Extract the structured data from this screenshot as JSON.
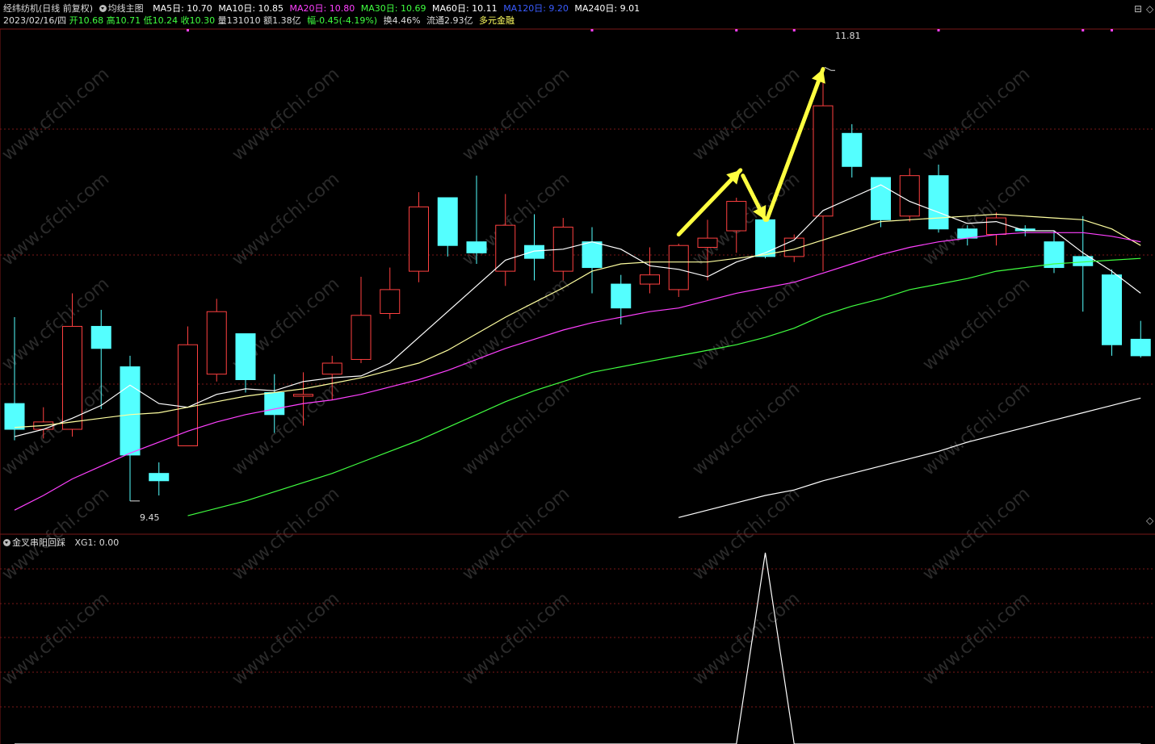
{
  "header": {
    "title": "经纬纺机(日线 前复权)",
    "indicator": "均线主图",
    "ma": [
      {
        "label": "MA5日: 10.70",
        "color": "#ffffff"
      },
      {
        "label": "MA10日: 10.85",
        "color": "#ffffff"
      },
      {
        "label": "MA20日: 10.80",
        "color": "#ff40ff"
      },
      {
        "label": "MA30日: 10.69",
        "color": "#40ff40"
      },
      {
        "label": "MA60日: 10.11",
        "color": "#ffffff"
      },
      {
        "label": "MA120日: 9.20",
        "color": "#3a5cff"
      },
      {
        "label": "MA240日: 9.01",
        "color": "#ffffff"
      }
    ]
  },
  "quote": {
    "date": "2023/02/16/四",
    "open": "开10.68",
    "high": "高10.71",
    "low": "低10.24",
    "close": "收10.30",
    "volume": "量131010",
    "amount": "额1.38亿",
    "change": "幅-0.45(-4.19%)",
    "turnover": "换4.46%",
    "float": "流通2.93亿",
    "margin": "多元金融"
  },
  "sub_header": {
    "indicator": "金叉串阳回踩",
    "value": "XG1: 0.00"
  },
  "controls": {
    "menu_icon": "⊟",
    "expand_icon": "◇"
  },
  "annotations": {
    "high_label": "11.81",
    "low_label": "9.45"
  },
  "watermark": "www.cfchi.com",
  "colors": {
    "up": "#ff4040",
    "down": "#54ffff",
    "grid": "#7a1818",
    "arrow": "#ffff40",
    "ma5": "#ffffff",
    "ma10": "#ffffa0",
    "ma20": "#ff40ff",
    "ma30": "#40ff40",
    "ma60": "#ffffff"
  },
  "chart_data": {
    "type": "candlestick",
    "price_range": [
      9.3,
      12.0
    ],
    "candles": [
      {
        "o": 9.98,
        "h": 10.45,
        "l": 9.78,
        "c": 9.84
      },
      {
        "o": 9.84,
        "h": 9.96,
        "l": 9.79,
        "c": 9.88
      },
      {
        "o": 9.84,
        "h": 10.58,
        "l": 9.8,
        "c": 10.4
      },
      {
        "o": 10.4,
        "h": 10.49,
        "l": 9.95,
        "c": 10.28
      },
      {
        "o": 10.18,
        "h": 10.24,
        "l": 9.45,
        "c": 9.7
      },
      {
        "o": 9.6,
        "h": 9.66,
        "l": 9.48,
        "c": 9.56
      },
      {
        "o": 9.75,
        "h": 10.4,
        "l": 9.75,
        "c": 10.3
      },
      {
        "o": 10.14,
        "h": 10.55,
        "l": 10.1,
        "c": 10.48
      },
      {
        "o": 10.36,
        "h": 10.36,
        "l": 10.04,
        "c": 10.11
      },
      {
        "o": 10.04,
        "h": 10.14,
        "l": 9.82,
        "c": 9.92
      },
      {
        "o": 10.02,
        "h": 10.15,
        "l": 9.86,
        "c": 10.03
      },
      {
        "o": 10.14,
        "h": 10.24,
        "l": 10.0,
        "c": 10.2
      },
      {
        "o": 10.22,
        "h": 10.67,
        "l": 10.2,
        "c": 10.46
      },
      {
        "o": 10.47,
        "h": 10.72,
        "l": 10.44,
        "c": 10.6
      },
      {
        "o": 10.7,
        "h": 11.13,
        "l": 10.64,
        "c": 11.05
      },
      {
        "o": 11.1,
        "h": 11.1,
        "l": 10.78,
        "c": 10.84
      },
      {
        "o": 10.86,
        "h": 11.22,
        "l": 10.74,
        "c": 10.8
      },
      {
        "o": 10.7,
        "h": 11.12,
        "l": 10.62,
        "c": 10.95
      },
      {
        "o": 10.84,
        "h": 11.01,
        "l": 10.65,
        "c": 10.77
      },
      {
        "o": 10.7,
        "h": 10.99,
        "l": 10.65,
        "c": 10.94
      },
      {
        "o": 10.86,
        "h": 10.94,
        "l": 10.58,
        "c": 10.72
      },
      {
        "o": 10.63,
        "h": 10.68,
        "l": 10.41,
        "c": 10.5
      },
      {
        "o": 10.63,
        "h": 10.83,
        "l": 10.58,
        "c": 10.68
      },
      {
        "o": 10.6,
        "h": 10.85,
        "l": 10.56,
        "c": 10.84
      },
      {
        "o": 10.83,
        "h": 10.98,
        "l": 10.65,
        "c": 10.88
      },
      {
        "o": 10.92,
        "h": 11.1,
        "l": 10.8,
        "c": 11.08
      },
      {
        "o": 10.98,
        "h": 11.0,
        "l": 10.77,
        "c": 10.78
      },
      {
        "o": 10.78,
        "h": 10.9,
        "l": 10.75,
        "c": 10.88
      },
      {
        "o": 11.0,
        "h": 11.81,
        "l": 10.7,
        "c": 11.6
      },
      {
        "o": 11.45,
        "h": 11.5,
        "l": 11.21,
        "c": 11.27
      },
      {
        "o": 11.21,
        "h": 11.21,
        "l": 10.94,
        "c": 10.98
      },
      {
        "o": 11.0,
        "h": 11.26,
        "l": 10.97,
        "c": 11.22
      },
      {
        "o": 11.22,
        "h": 11.28,
        "l": 10.91,
        "c": 10.93
      },
      {
        "o": 10.93,
        "h": 10.95,
        "l": 10.84,
        "c": 10.88
      },
      {
        "o": 10.9,
        "h": 11.02,
        "l": 10.84,
        "c": 10.99
      },
      {
        "o": 10.93,
        "h": 10.95,
        "l": 10.89,
        "c": 10.92
      },
      {
        "o": 10.86,
        "h": 10.92,
        "l": 10.69,
        "c": 10.72
      },
      {
        "o": 10.78,
        "h": 11.0,
        "l": 10.48,
        "c": 10.73
      },
      {
        "o": 10.68,
        "h": 10.71,
        "l": 10.24,
        "c": 10.3
      },
      {
        "o": 10.33,
        "h": 10.43,
        "l": 10.23,
        "c": 10.24
      }
    ],
    "ma5": [
      9.8,
      9.84,
      9.9,
      9.97,
      10.08,
      9.98,
      9.96,
      10.03,
      10.06,
      10.05,
      10.1,
      10.12,
      10.13,
      10.2,
      10.34,
      10.48,
      10.62,
      10.76,
      10.81,
      10.82,
      10.86,
      10.82,
      10.73,
      10.71,
      10.67,
      10.75,
      10.8,
      10.87,
      11.03,
      11.1,
      11.17,
      11.08,
      11.02,
      10.96,
      10.97,
      10.92,
      10.92,
      10.8,
      10.7,
      10.58
    ],
    "ma10": [
      9.85,
      9.86,
      9.88,
      9.9,
      9.92,
      9.93,
      9.96,
      9.99,
      10.02,
      10.04,
      10.06,
      10.09,
      10.12,
      10.16,
      10.2,
      10.27,
      10.36,
      10.45,
      10.53,
      10.61,
      10.7,
      10.74,
      10.75,
      10.75,
      10.75,
      10.77,
      10.79,
      10.82,
      10.87,
      10.92,
      10.97,
      10.98,
      10.99,
      11.0,
      11.01,
      11.0,
      10.99,
      10.98,
      10.93,
      10.84
    ],
    "ma20": [
      9.4,
      9.48,
      9.57,
      9.64,
      9.71,
      9.77,
      9.83,
      9.88,
      9.92,
      9.95,
      9.98,
      10.0,
      10.03,
      10.07,
      10.11,
      10.16,
      10.22,
      10.28,
      10.33,
      10.38,
      10.42,
      10.45,
      10.48,
      10.5,
      10.54,
      10.58,
      10.61,
      10.64,
      10.69,
      10.74,
      10.79,
      10.83,
      10.86,
      10.88,
      10.9,
      10.91,
      10.91,
      10.91,
      10.89,
      10.86
    ],
    "ma30": [
      null,
      null,
      null,
      null,
      null,
      null,
      9.37,
      9.41,
      9.45,
      9.5,
      9.55,
      9.6,
      9.66,
      9.72,
      9.78,
      9.85,
      9.92,
      9.99,
      10.05,
      10.1,
      10.15,
      10.18,
      10.21,
      10.24,
      10.27,
      10.3,
      10.34,
      10.39,
      10.46,
      10.51,
      10.55,
      10.6,
      10.63,
      10.66,
      10.7,
      10.72,
      10.74,
      10.75,
      10.76,
      10.77
    ],
    "ma60": [
      null,
      null,
      null,
      null,
      null,
      null,
      null,
      null,
      null,
      null,
      null,
      null,
      null,
      null,
      null,
      null,
      null,
      null,
      null,
      null,
      null,
      null,
      null,
      9.36,
      9.4,
      9.44,
      9.48,
      9.51,
      9.56,
      9.6,
      9.64,
      9.68,
      9.72,
      9.77,
      9.81,
      9.85,
      9.89,
      9.93,
      9.97,
      10.01
    ],
    "xg1": [
      0,
      0,
      0,
      0,
      0,
      0,
      0,
      0,
      0,
      0,
      0,
      0,
      0,
      0,
      0,
      0,
      0,
      0,
      0,
      0,
      0,
      0,
      0,
      0,
      0,
      0,
      1,
      0,
      0,
      0,
      0,
      0,
      0,
      0,
      0,
      0,
      0,
      0,
      0,
      0
    ]
  }
}
